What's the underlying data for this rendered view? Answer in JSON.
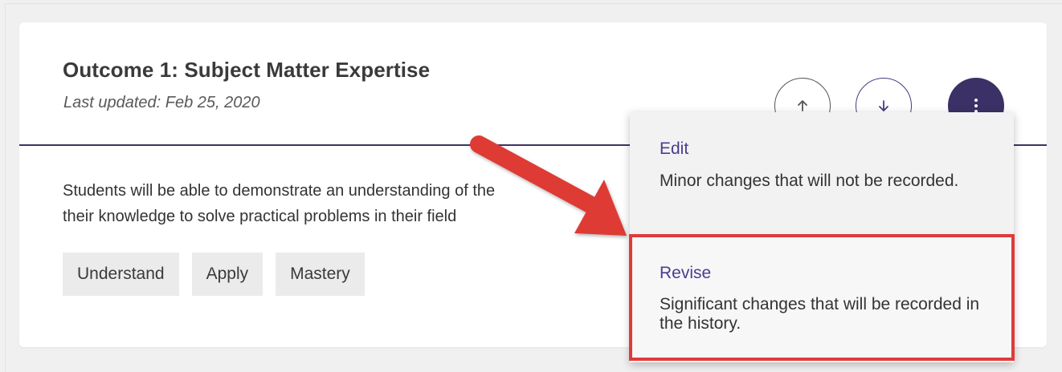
{
  "outcome": {
    "title": "Outcome 1: Subject Matter Expertise",
    "last_updated": "Last updated: Feb 25, 2020",
    "description_line1": "Students will be able to demonstrate an understanding of the",
    "description_line2": "their knowledge to solve practical problems in their field",
    "tags": [
      "Understand",
      "Apply",
      "Mastery"
    ]
  },
  "actions": {
    "move_up_icon": "arrow-up-icon",
    "move_down_icon": "arrow-down-icon",
    "more_icon": "vertical-dots-icon"
  },
  "menu": {
    "edit": {
      "title": "Edit",
      "description": "Minor changes that will not be recorded."
    },
    "revise": {
      "title": "Revise",
      "description": "Significant changes that will be recorded in the history."
    }
  },
  "colors": {
    "primary": "#3b3166",
    "link": "#4a3d8f",
    "annotation": "#df3b3b"
  }
}
